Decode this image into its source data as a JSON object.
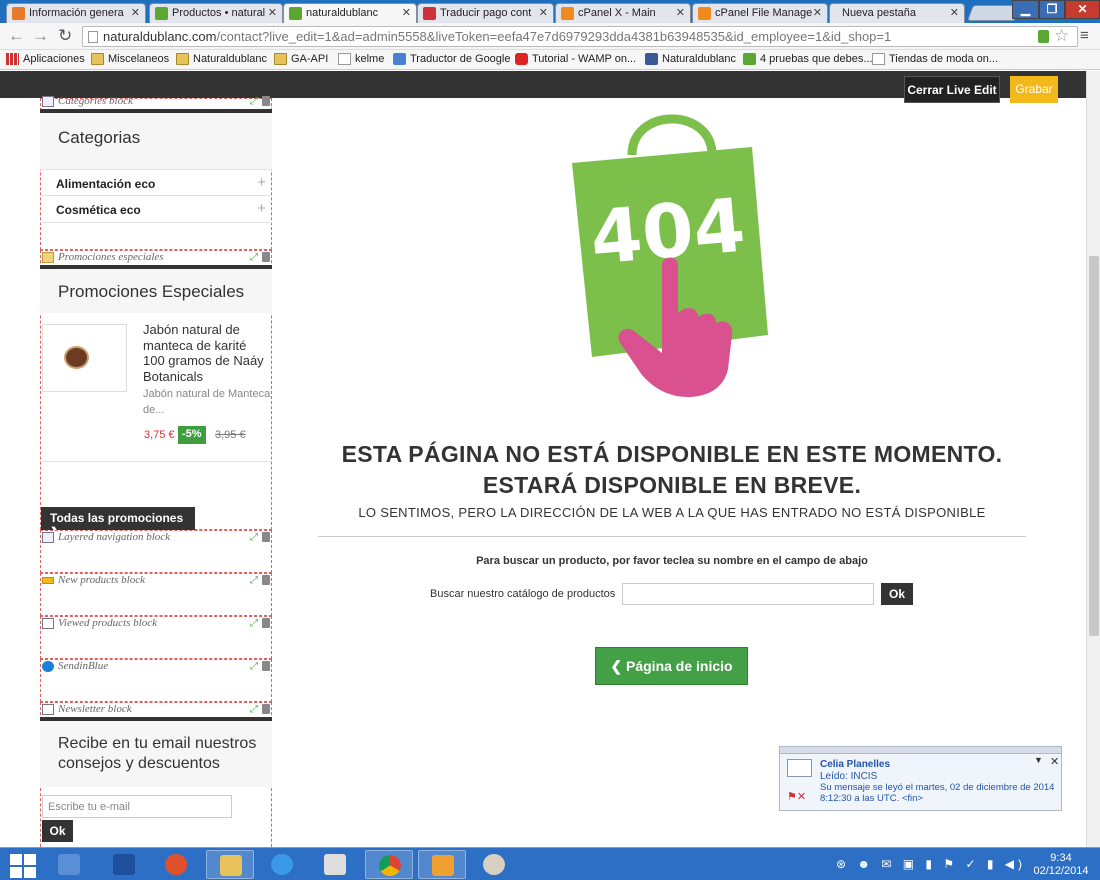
{
  "browser": {
    "tabs": [
      {
        "label": "Información genera",
        "icon_color": "#e8782a"
      },
      {
        "label": "Productos • natural",
        "icon_color": "#5aa832"
      },
      {
        "label": "naturaldublanc",
        "icon_color": "#5aa832"
      },
      {
        "label": "Traducir pago cont",
        "icon_color": "#d0303a"
      },
      {
        "label": "cPanel X - Main",
        "icon_color": "#f08a1c"
      },
      {
        "label": "cPanel File Manage",
        "icon_color": "#f08a1c"
      },
      {
        "label": "Nueva pestaña",
        "icon_color": ""
      }
    ],
    "url_domain": "naturaldublanc.com",
    "url_rest": "/contact?live_edit=1&ad=admin5558&liveToken=eefa47e7d6979293dda4381b63948535&id_employee=1&id_shop=1",
    "bookmarks": [
      "Aplicaciones",
      "Miscelaneos",
      "Naturaldublanc",
      "GA-API",
      "kelme",
      "Traductor de Google",
      "Tutorial - WAMP on...",
      "Naturaldublanc",
      "4 pruebas que debes...",
      "Tiendas de moda on..."
    ]
  },
  "live_edit": {
    "close_label": "Cerrar Live Edit",
    "save_label": "Grabar"
  },
  "sidebar": {
    "blocks": {
      "categories": "Categories block",
      "promos": "Promociones especiales",
      "layered": "Layered navigation block",
      "new_products": "New products block",
      "viewed": "Viewed products block",
      "sendinblue": "SendinBlue",
      "newsletter": "Newsletter block"
    },
    "categories_title": "Categorias",
    "categories": [
      "Alimentación eco",
      "Cosmética eco"
    ],
    "promos_title": "Promociones Especiales",
    "product": {
      "name": "Jabón natural de manteca de karité 100 gramos de Naáy Botanicals",
      "desc": "Jabón natural de Manteca de...",
      "price": "3,75 €",
      "discount": "-5%",
      "old_price": "3,95 €"
    },
    "all_promos": "Todas las promociones ❯",
    "newsletter_title": "Recibe en tu email nuestros consejos y descuentos",
    "newsletter_placeholder": "Escribe tu e-mail",
    "newsletter_ok": "Ok"
  },
  "main": {
    "code": "404",
    "title_line1": "ESTA PÁGINA NO ESTÁ DISPONIBLE EN ESTE MOMENTO.",
    "title_line2": "ESTARÁ DISPONIBLE EN BREVE.",
    "subtitle": "LO SENTIMOS, PERO LA DIRECCIÓN DE LA WEB A LA QUE HAS ENTRADO NO ESTÁ DISPONIBLE",
    "search_note": "Para buscar un producto, por favor teclea su nombre en el campo de abajo",
    "search_label": "Buscar nuestro catálogo de productos",
    "search_ok": "Ok",
    "home_button": "❮  Página de inicio",
    "colors": {
      "bag": "#7cc04b",
      "hand": "#d9528f",
      "home_button": "#43a047"
    }
  },
  "notification": {
    "name": "Celia Planelles",
    "line1": "Leído: INCIS",
    "line2": "Su mensaje se leyó el martes, 02 de diciembre de 2014",
    "line3": "8:12:30 a las UTC.  <fin>"
  },
  "taskbar": {
    "time": "9:34",
    "date": "02/12/2014"
  }
}
